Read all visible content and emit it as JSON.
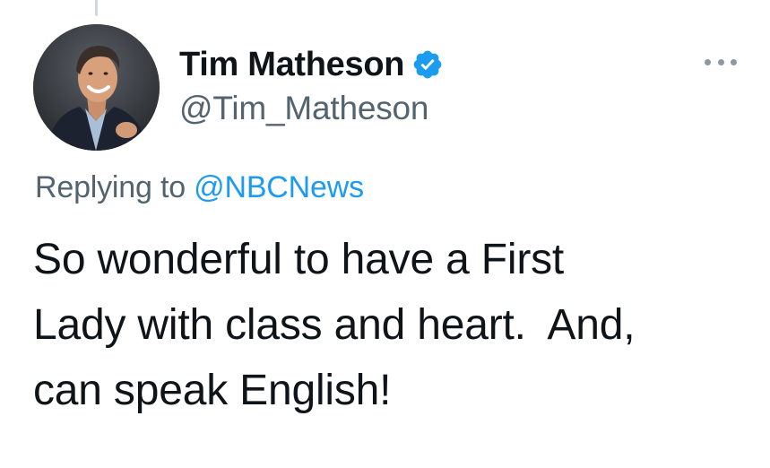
{
  "tweet": {
    "author": {
      "display_name": "Tim Matheson",
      "handle": "@Tim_Matheson",
      "verified": true,
      "avatar_icon": "avatar-photo"
    },
    "menu_icon": "more-horizontal-icon",
    "reply": {
      "prefix": "Replying to",
      "mention": "@NBCNews"
    },
    "text_lines": [
      "So wonderful to have a First",
      "Lady with class and heart.  And,",
      "can speak English!"
    ]
  },
  "colors": {
    "text_primary": "#0f1419",
    "text_secondary": "#536471",
    "accent": "#1d9bf0"
  }
}
